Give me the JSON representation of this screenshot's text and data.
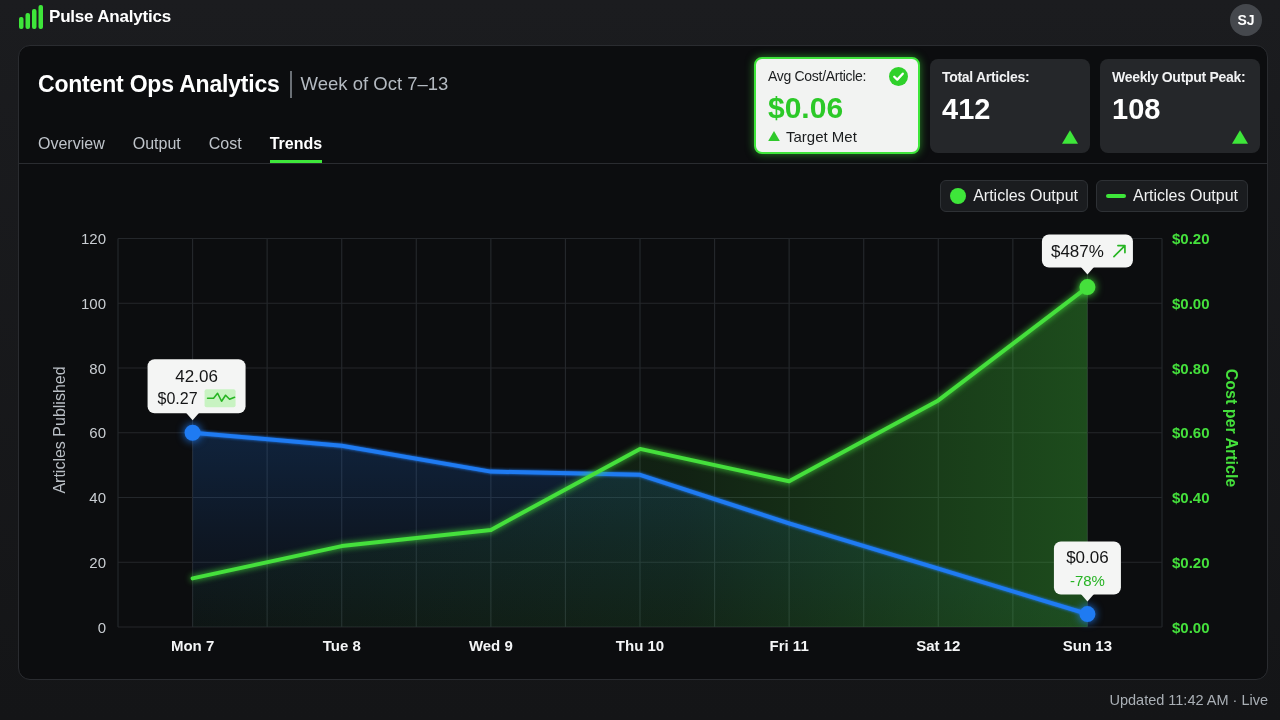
{
  "topbar": {
    "app_name": "Pulse Analytics",
    "avatar_initials": "SJ"
  },
  "header": {
    "title": "Content Ops Analytics",
    "subtitle": "Week of Oct 7–13"
  },
  "tabs": [
    {
      "label": "Overview",
      "selected": false
    },
    {
      "label": "Output",
      "selected": false
    },
    {
      "label": "Cost",
      "selected": false
    },
    {
      "label": "Trends",
      "selected": true
    }
  ],
  "kpis": [
    {
      "label": "Avg Cost/Article:",
      "value": "$0.06",
      "status": "Target Met",
      "highlighted": true
    },
    {
      "label": "Total Articles:",
      "value": "412",
      "highlighted": false
    },
    {
      "label": "Weekly Output Peak:",
      "value": "108",
      "highlighted": false
    }
  ],
  "chart": {
    "legend": [
      {
        "kind": "dot",
        "label": "Articles Output"
      },
      {
        "kind": "line",
        "label": "Articles Output"
      }
    ],
    "chart_data": {
      "type": "area",
      "ylabel": "Articles Published",
      "grid": true,
      "categories": [
        "Mon 7",
        "Tue 8",
        "Wed 9",
        "Thu 10",
        "Fri 11",
        "Sat 12",
        "Sun 13"
      ],
      "series": [
        {
          "color": "#1f7bf2",
          "values": [
            60,
            56,
            48,
            47,
            32,
            18,
            4
          ]
        },
        {
          "name": "Cost per Article",
          "color": "#45e03c",
          "axis": "y2",
          "values": [
            0.15,
            0.25,
            0.3,
            0.55,
            0.45,
            0.7,
            1.05
          ]
        }
      ],
      "ylim": [
        0,
        120
      ],
      "yticks": [
        0,
        20,
        40,
        60,
        80,
        100,
        120
      ],
      "y2lim": [
        0,
        1.2
      ],
      "y2ticks": [
        {
          "value": 0,
          "label": "$0.00"
        },
        {
          "value": 0.2,
          "label": "$0.20"
        },
        {
          "value": 0.4,
          "label": "$0.40"
        },
        {
          "value": 0.6,
          "label": "$0.60"
        },
        {
          "value": 0.8,
          "label": "$0.80"
        }
      ]
    },
    "y2_labels_above": [
      "$0.20",
      "$0.00"
    ],
    "tooltips": [
      {
        "kind": "value-detail",
        "secondary": false,
        "last_point": false,
        "text": "42.06",
        "detail": "$0.27"
      },
      {
        "kind": "trend",
        "secondary": true,
        "last_point": true,
        "text": "$487%"
      },
      {
        "kind": "change",
        "secondary": false,
        "last_point": true,
        "text": "$0.06",
        "detail": "-78%"
      }
    ]
  },
  "status_bar": {
    "text": "Updated 11:42 AM · Live"
  }
}
